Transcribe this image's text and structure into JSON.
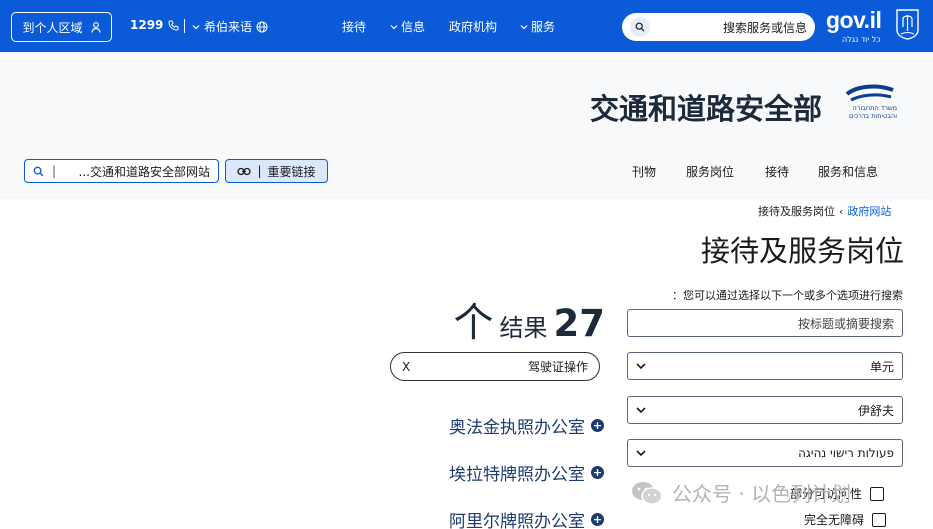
{
  "topbar": {
    "personal_area": "到个人区域",
    "phone": "1299",
    "language": "希伯来语",
    "nav": [
      "接待",
      "信息",
      "政府机构",
      "服务"
    ],
    "search_placeholder": "搜索服务或信息",
    "logo": "gov.il",
    "logo_sub": "כל יוד נגלה"
  },
  "ministry": {
    "title": "交通和道路安全部",
    "logo_text_line1": "משרד התחבורה",
    "logo_text_line2": "והבטיחות בדרכים",
    "site_search": "...交通和道路安全部网站",
    "important_links": "重要链接",
    "nav": [
      "刊物",
      "服务岗位",
      "接待",
      "服务和信息"
    ]
  },
  "breadcrumb": {
    "home": "政府网站",
    "current": "接待及服务岗位"
  },
  "page": {
    "title": "接待及服务岗位",
    "filter_hint": "：您可以通过选择以下一个或多个选项进行搜索"
  },
  "filters": {
    "search_placeholder": "按标题或摘要搜索",
    "unit": "单元",
    "city": "伊舒夫",
    "topic": "פעולות רישוי נהיגה",
    "partial_access": "部分可访问性",
    "full_access": "完全无障碍"
  },
  "results": {
    "count_prefix": "个",
    "count_label": "结果",
    "count": "27",
    "active_filter": "驾驶证操作",
    "active_filter_remove": "X",
    "items": [
      "奥法金执照办公室",
      "埃拉特牌照办公室",
      "阿里尔牌照办公室"
    ]
  },
  "watermark": {
    "text": "公众号 · 以色列计划"
  },
  "colors": {
    "brand_blue": "#0b5bd9",
    "link_navy": "#1c3b6e"
  }
}
